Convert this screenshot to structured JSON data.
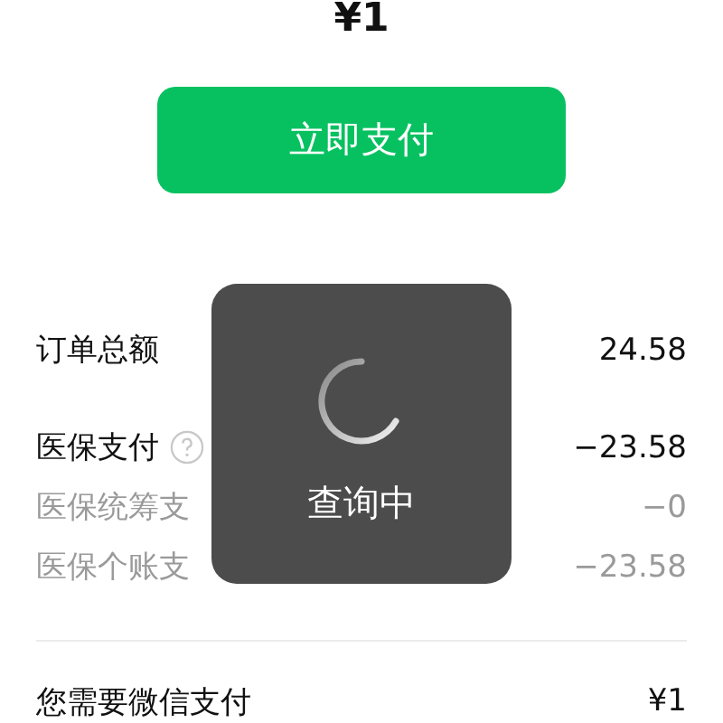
{
  "amount": "¥1",
  "pay_button": "立即支付",
  "rows": [
    {
      "kind": "main",
      "label": "订单总额",
      "value": "24.58",
      "help": false
    },
    {
      "kind": "main",
      "label": "医保支付",
      "value": "−23.58",
      "help": true
    },
    {
      "kind": "sub",
      "label": "医保统筹支",
      "value": "−0",
      "help": false
    },
    {
      "kind": "sub",
      "label": "医保个账支",
      "value": "−23.58",
      "help": false
    }
  ],
  "total": {
    "label": "您需要微信支付",
    "value": "¥1"
  },
  "toast": {
    "text": "查询中"
  }
}
